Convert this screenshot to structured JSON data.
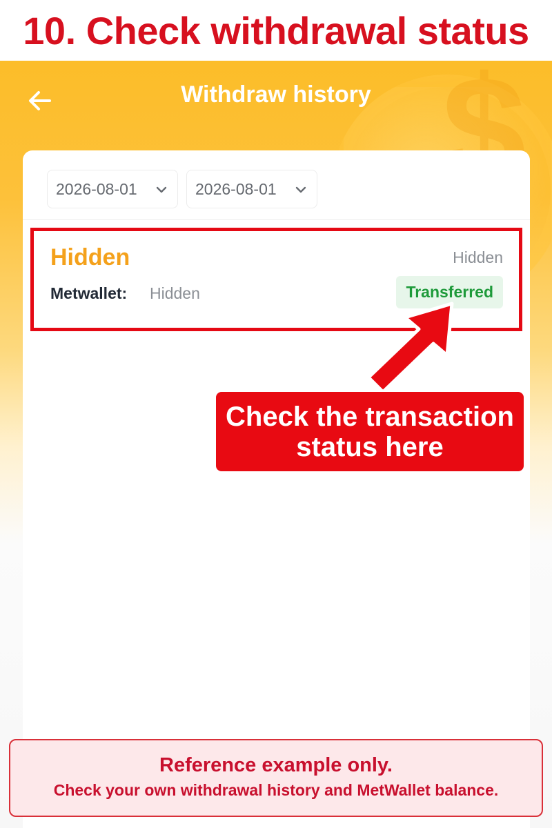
{
  "step": {
    "title": "10. Check withdrawal status"
  },
  "header": {
    "title": "Withdraw history",
    "back_icon": "arrow-left-icon"
  },
  "filters": {
    "date_from": "2026-08-01",
    "date_to": "2026-08-01",
    "dropdown_icon": "chevron-down-icon"
  },
  "record": {
    "name": "Hidden",
    "time": "Hidden",
    "wallet_label": "Metwallet:",
    "wallet_value": "Hidden",
    "status": "Transferred"
  },
  "annotation": {
    "callout": "Check the transaction status here",
    "arrow_icon": "arrow-up-right-icon"
  },
  "disclaimer": {
    "line1": "Reference example only.",
    "line2": "Check your own withdrawal history and MetWallet balance."
  },
  "colors": {
    "brand_red": "#d7101f",
    "header_yellow": "#fcbd29",
    "accent_orange": "#f4a11b",
    "status_green": "#1e9a3a",
    "status_bg": "#e7f6ea"
  }
}
